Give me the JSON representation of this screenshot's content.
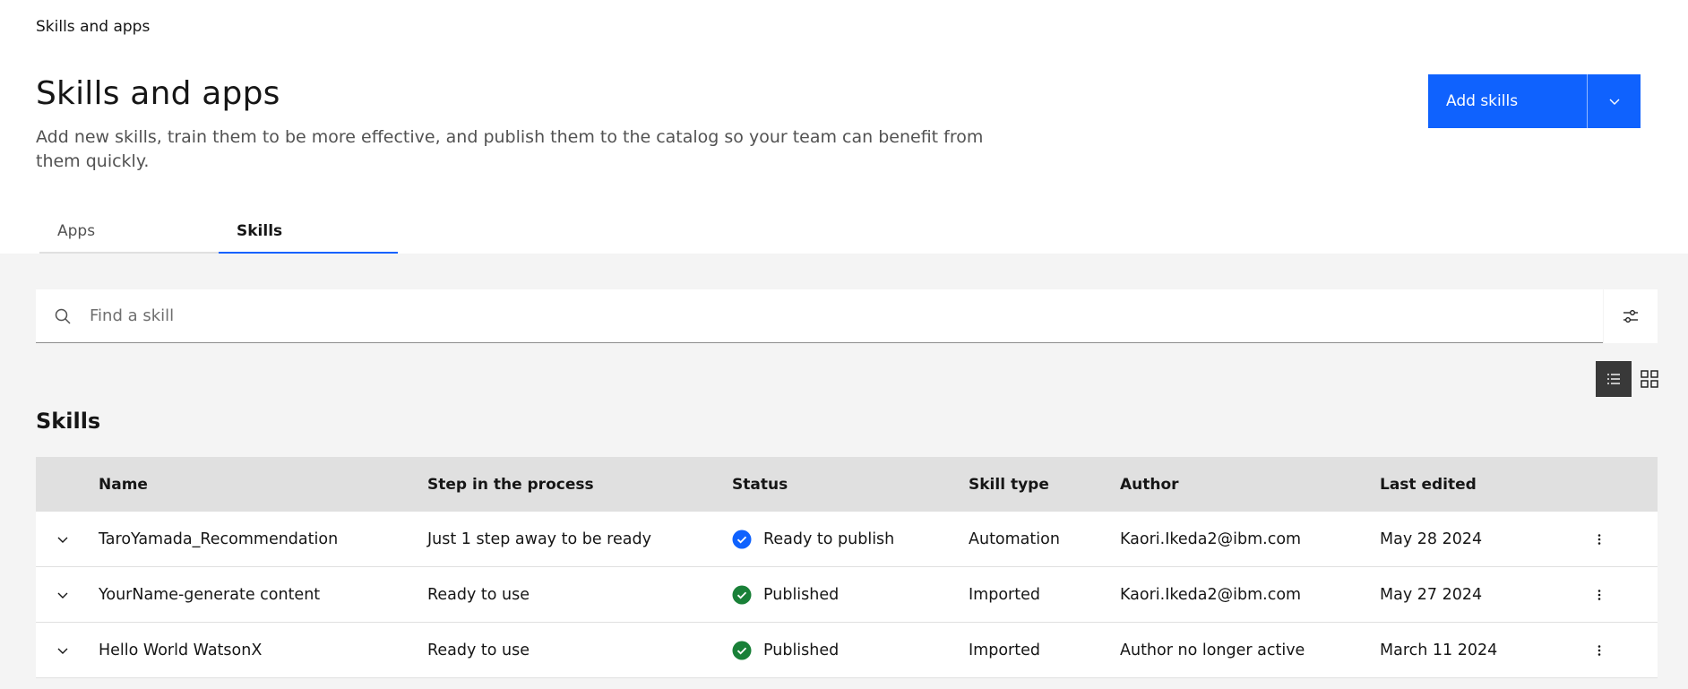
{
  "breadcrumb": "Skills and apps",
  "page": {
    "title": "Skills and apps",
    "description": "Add new skills, train them to be more effective, and publish them to the catalog so your team can benefit from them quickly."
  },
  "add_button": {
    "label": "Add skills",
    "caret_icon": "chevron-down-icon"
  },
  "tabs": [
    {
      "label": "Apps",
      "active": false
    },
    {
      "label": "Skills",
      "active": true
    }
  ],
  "search": {
    "placeholder": "Find a skill",
    "icon": "search-icon",
    "filter_icon": "sliders-icon"
  },
  "view_toggle": {
    "list_icon": "list-view-icon",
    "grid_icon": "grid-view-icon",
    "selected": "list"
  },
  "section_title": "Skills",
  "table": {
    "headers": {
      "name": "Name",
      "step": "Step in the process",
      "status": "Status",
      "type": "Skill type",
      "author": "Author",
      "edited": "Last edited"
    },
    "rows": [
      {
        "name": "TaroYamada_Recommendation",
        "step": "Just 1 step away to be ready",
        "status": "Ready to publish",
        "status_color": "#0f62fe",
        "type": "Automation",
        "author": "Kaori.Ikeda2@ibm.com",
        "edited": "May 28 2024"
      },
      {
        "name": "YourName-generate content",
        "step": "Ready to use",
        "status": "Published",
        "status_color": "#198038",
        "type": "Imported",
        "author": "Kaori.Ikeda2@ibm.com",
        "edited": "May 27 2024"
      },
      {
        "name": "Hello World WatsonX",
        "step": "Ready to use",
        "status": "Published",
        "status_color": "#198038",
        "type": "Imported",
        "author": "Author no longer active",
        "edited": "March 11 2024"
      }
    ]
  },
  "colors": {
    "accent": "#0f62fe",
    "success": "#198038"
  }
}
